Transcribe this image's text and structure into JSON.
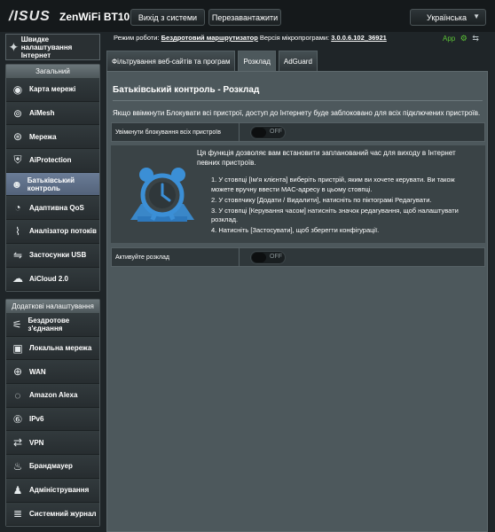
{
  "header": {
    "brand": "/ISUS",
    "model": "ZenWiFi BT10",
    "logout_label": "Вихід з системи",
    "reboot_label": "Перезавантажити",
    "language": "Українська"
  },
  "status": {
    "mode_label": "Режим роботи:",
    "mode_value": "Бездротовий маршрутизатор",
    "firmware_label": "Версія мікропрограми:",
    "firmware_value": "3.0.0.6.102_36921",
    "app_label": "App"
  },
  "sidebar": {
    "quick_setup": "Швидке налаштування Інтернет",
    "general_title": "Загальний",
    "general_items": [
      {
        "label": "Карта мережі",
        "icon": "network-map-icon"
      },
      {
        "label": "AiMesh",
        "icon": "aimesh-icon"
      },
      {
        "label": "Мережа",
        "icon": "guest-network-icon"
      },
      {
        "label": "AiProtection",
        "icon": "aiprotection-icon"
      },
      {
        "label": "Батьківський контроль",
        "icon": "parental-control-icon"
      },
      {
        "label": "Адаптивна QoS",
        "icon": "qos-icon"
      },
      {
        "label": "Аналізатор потоків",
        "icon": "traffic-analyzer-icon"
      },
      {
        "label": "Застосунки USB",
        "icon": "usb-icon"
      },
      {
        "label": "AiCloud 2.0",
        "icon": "aicloud-icon"
      }
    ],
    "advanced_title": "Додаткові налаштування",
    "advanced_items": [
      {
        "label": "Бездротове з'єднання",
        "icon": "wireless-icon"
      },
      {
        "label": "Локальна мережа",
        "icon": "lan-icon"
      },
      {
        "label": "WAN",
        "icon": "wan-icon"
      },
      {
        "label": "Amazon Alexa",
        "icon": "alexa-icon"
      },
      {
        "label": "IPv6",
        "icon": "ipv6-icon"
      },
      {
        "label": "VPN",
        "icon": "vpn-icon"
      },
      {
        "label": "Брандмауер",
        "icon": "firewall-icon"
      },
      {
        "label": "Адміністрування",
        "icon": "administration-icon"
      },
      {
        "label": "Системний журнал",
        "icon": "system-log-icon"
      }
    ]
  },
  "tabs": [
    "Фільтрування веб-сайтів та програм",
    "Розклад",
    "AdGuard"
  ],
  "main": {
    "title": "Батьківський контроль - Розклад",
    "description": "Якщо ввімкнути Блокувати всі пристрої, доступ до Інтернету буде заблоковано для всіх підключених пристроїв.",
    "block_all_label": "Увімкнути блокування всіх пристроїв",
    "block_all_state": "OFF",
    "intro": "Ця функція дозволяє вам встановити запланований час для виходу в Інтернет певних пристроїв.",
    "steps": [
      "1. У стовпці [Ім'я клієнта] виберіть пристрій, яким ви хочете керувати. Ви також можете вручну ввести MAC-адресу в цьому стовпці.",
      "2. У стовпчику [Додати / Видалити], натисніть по піктограмі Редагувати.",
      "3. У стовпці [Керування часом] натисніть значок редагування, щоб налаштувати розклад.",
      "4. Натисніть [Застосувати], щоб зберегти конфігурації."
    ],
    "schedule_label": "Активуйте розклад",
    "schedule_state": "OFF"
  },
  "colors": {
    "accent_active": "#5f7088",
    "clock_blue": "#3b8fd6",
    "app_green": "#5bc236"
  }
}
